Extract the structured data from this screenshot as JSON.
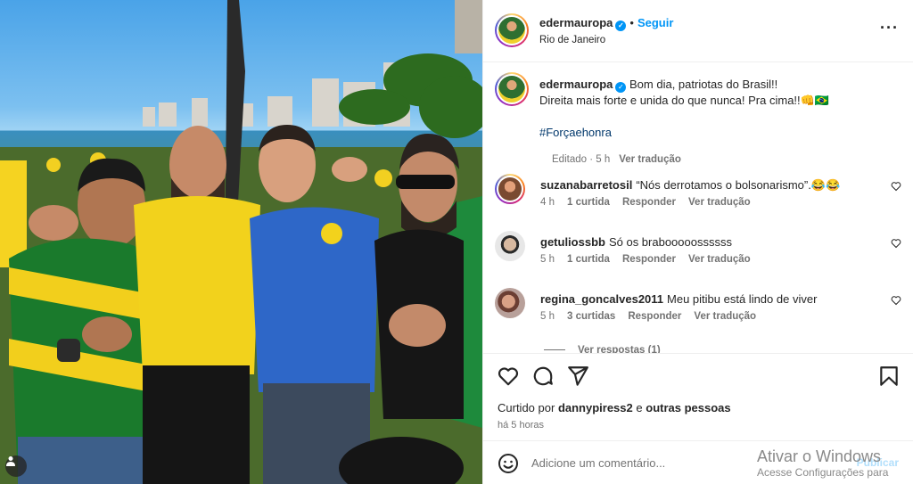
{
  "post": {
    "username": "edermauropa",
    "follow_label": "Seguir",
    "location": "Rio de Janeiro",
    "photo_alt": "Quatro homens posando em manifestação na praia"
  },
  "caption": {
    "username": "edermauropa",
    "line1": "Bom dia, patriotas do Brasil!!",
    "line2": "Direita mais forte e unida do que nunca! Pra cima!!👊🇧🇷",
    "hashtag": "#Forçaehonra",
    "edited": "Editado · 5 h",
    "translate": "Ver tradução"
  },
  "comments": [
    {
      "username": "suzanabarretosil",
      "text": "“Nós derrotamos o bolsonarismo”.😂😂",
      "time": "4 h",
      "likes": "1 curtida",
      "reply": "Responder",
      "translate": "Ver tradução"
    },
    {
      "username": "getuliossbb",
      "text": "Só os brabooooossssss",
      "time": "5 h",
      "likes": "1 curtida",
      "reply": "Responder",
      "translate": "Ver tradução"
    },
    {
      "username": "regina_goncalves2011",
      "text": "Meu pitibu está lindo de viver",
      "time": "5 h",
      "likes": "3 curtidas",
      "reply": "Responder",
      "translate": "Ver tradução"
    }
  ],
  "view_replies": "Ver respostas (1)",
  "likes": {
    "prefix": "Curtido por",
    "user": "dannypiress2",
    "middle": "e",
    "others": "outras pessoas"
  },
  "time_ago": "há 5 horas",
  "add_comment": {
    "placeholder": "Adicione um comentário...",
    "post_label": "Publicar"
  },
  "watermark": {
    "title": "Ativar o Windows",
    "subtitle": "Acesse Configurações para"
  },
  "icons": {
    "heart": "heart-icon",
    "comment": "comment-icon",
    "share": "share-icon",
    "save": "bookmark-icon",
    "more": "more-options-icon",
    "emoji": "emoji-icon"
  },
  "colors": {
    "accent": "#0095f6",
    "text": "#262626",
    "secondary": "#737373"
  }
}
